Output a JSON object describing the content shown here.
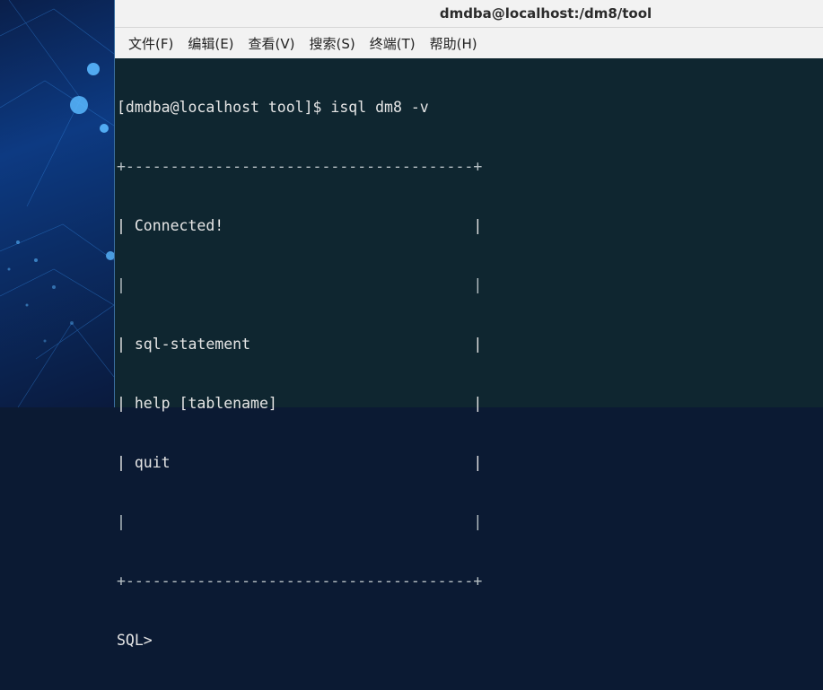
{
  "window": {
    "title": "dmdba@localhost:/dm8/tool"
  },
  "menu": {
    "items": [
      "文件(F)",
      "编辑(E)",
      "查看(V)",
      "搜索(S)",
      "终端(T)",
      "帮助(H)"
    ]
  },
  "terminal": {
    "prompt": "[dmdba@localhost tool]$ isql dm8 -v",
    "lines": [
      "+---------------------------------------+",
      "| Connected!                            |",
      "|                                       |",
      "| sql-statement                         |",
      "| help [tablename]                      |",
      "| quit                                  |",
      "|                                       |",
      "+---------------------------------------+"
    ],
    "sql_prompt": "SQL>"
  }
}
